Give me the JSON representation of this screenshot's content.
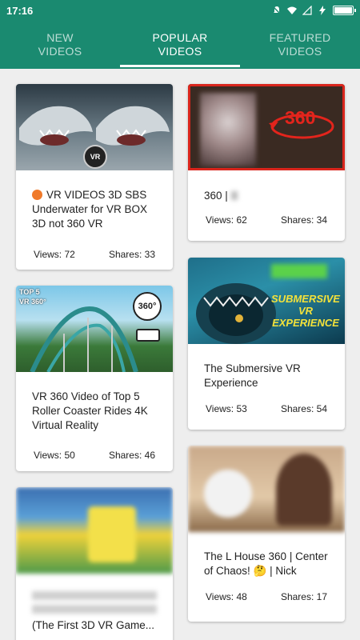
{
  "statusbar": {
    "time": "17:16"
  },
  "tabs": [
    {
      "label": "NEW\nVIDEOS",
      "active": false
    },
    {
      "label": "POPULAR\nVIDEOS",
      "active": true
    },
    {
      "label": "FEATURED\nVIDEOS",
      "active": false
    }
  ],
  "cards": [
    {
      "title": "VR VIDEOS 3D SBS Underwater for VR BOX 3D not 360 VR",
      "views": "Views: 72",
      "shares": "Shares: 33",
      "thumb_badge": "VR"
    },
    {
      "title": "360 |",
      "views": "Views: 62",
      "shares": "Shares: 34",
      "thumb_badge": "360"
    },
    {
      "title": "VR 360 Video of Top 5 Roller Coaster Rides 4K Virtual Reality",
      "views": "Views: 50",
      "shares": "Shares: 46",
      "thumb_badge": "360°",
      "thumb_label": "TOP 5\nVR 360°"
    },
    {
      "title": "The        Submersive VR Experience",
      "views": "Views: 53",
      "shares": "Shares: 54",
      "thumb_badge": "SUBMERSIVE VR EXPERIENCE"
    },
    {
      "title": "(The First 3D VR Game...",
      "views": "",
      "shares": ""
    },
    {
      "title": "The L     House 360 | Center of Chaos! 🤔 | Nick",
      "views": "Views: 48",
      "shares": "Shares: 17"
    }
  ]
}
